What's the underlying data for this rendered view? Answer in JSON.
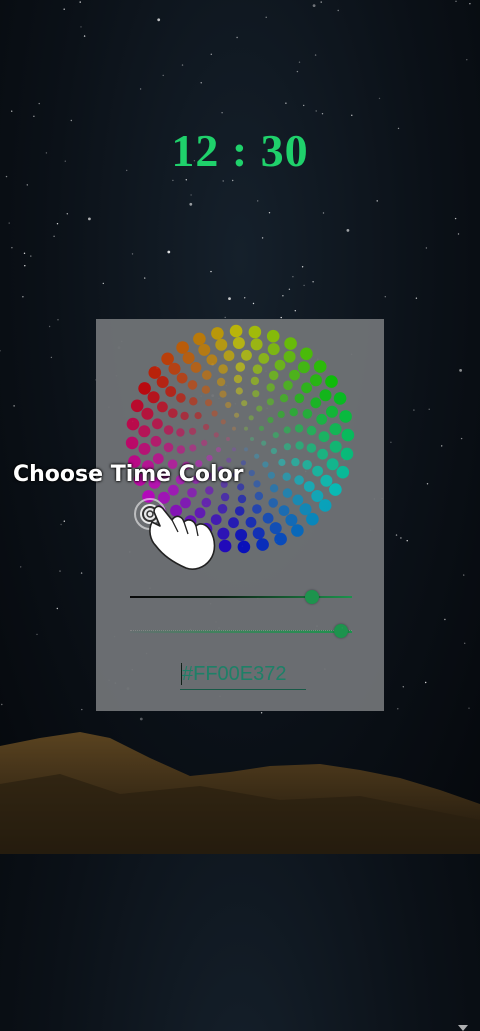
{
  "clock": {
    "time": "12 : 30",
    "color": "#1fd16b"
  },
  "color_picker": {
    "accent": "#1f9a50",
    "value_slider": 0.84,
    "alpha_slider": 0.98,
    "hex_value": "#FF00E372"
  },
  "tutorial": {
    "hint": "Choose Time Color"
  },
  "icons": {
    "hand": "tap-hand-icon",
    "wheel": "color-wheel-icon"
  }
}
